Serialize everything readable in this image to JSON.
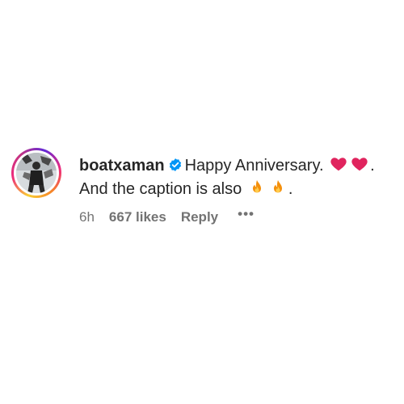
{
  "comment": {
    "username": "boatxaman",
    "verified_icon": "verified-badge-icon",
    "text_part1": "Happy Anniversary.",
    "emoji_hearts": [
      "red-heart-icon",
      "red-heart-icon"
    ],
    "text_part1_end": ".",
    "text_part2": "And the caption is also",
    "emoji_fire": [
      "fire-icon",
      "fire-icon"
    ],
    "text_part2_end": ".",
    "time": "6h",
    "likes": "667 likes",
    "reply_label": "Reply",
    "more_label": "•••"
  },
  "colors": {
    "verified_blue": "#0095f6",
    "heart_red": "#e0245e",
    "meta_gray": "#737373"
  }
}
